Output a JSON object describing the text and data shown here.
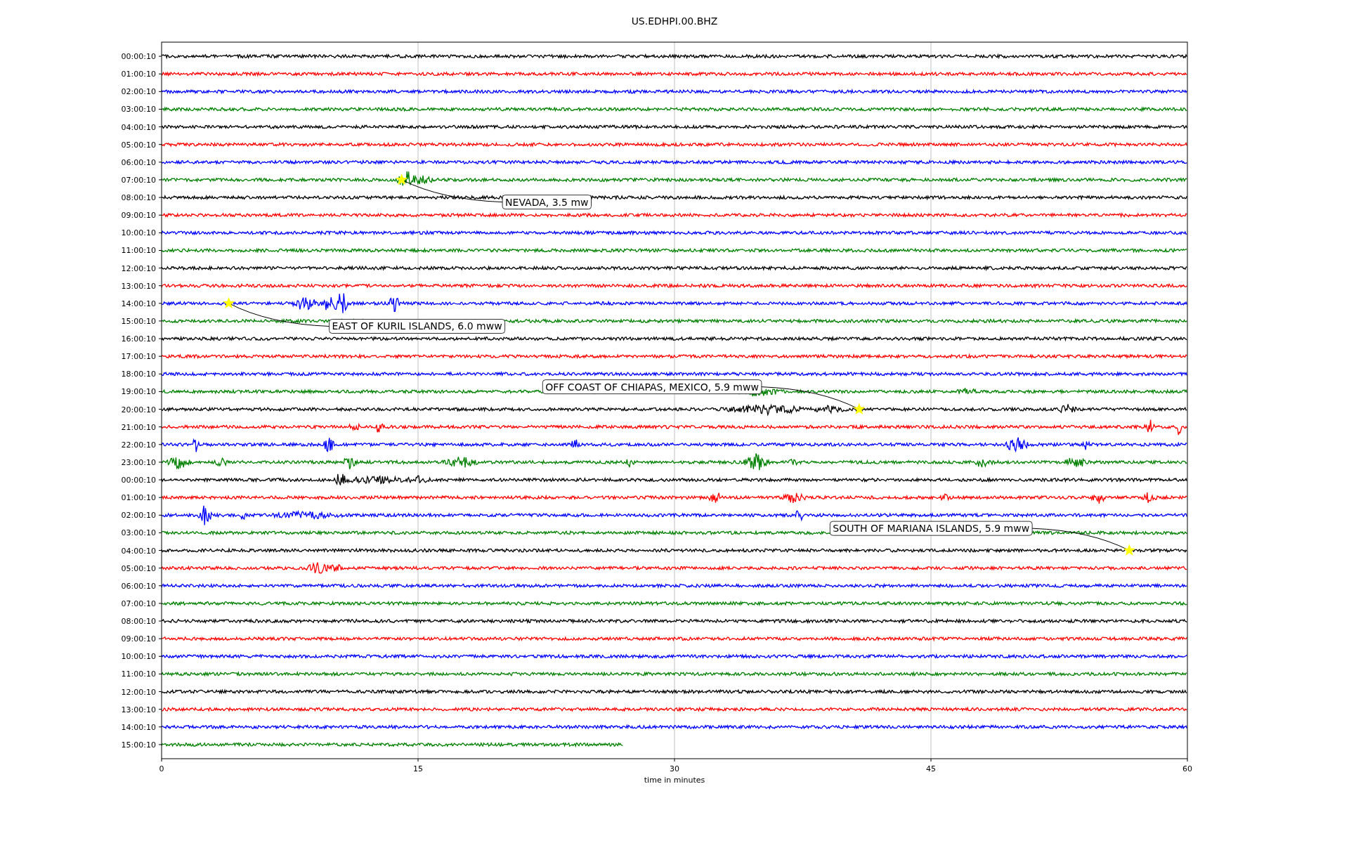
{
  "figure": {
    "title": "US.EDHPI.00.BHZ",
    "rows": [
      {
        "label": "00:00:10",
        "color": "#000000",
        "level": 1
      },
      {
        "label": "01:00:10",
        "color": "#ff0000",
        "level": 1
      },
      {
        "label": "02:00:10",
        "color": "#0000ff",
        "level": 1
      },
      {
        "label": "03:00:10",
        "color": "#008000",
        "level": 1
      },
      {
        "label": "04:00:10",
        "color": "#000000",
        "level": 1
      },
      {
        "label": "05:00:10",
        "color": "#ff0000",
        "level": 1
      },
      {
        "label": "06:00:10",
        "color": "#0000ff",
        "level": 1
      },
      {
        "label": "07:00:10",
        "color": "#008000",
        "level": 1
      },
      {
        "label": "08:00:10",
        "color": "#000000",
        "level": 1
      },
      {
        "label": "09:00:10",
        "color": "#ff0000",
        "level": 1
      },
      {
        "label": "10:00:10",
        "color": "#0000ff",
        "level": 1
      },
      {
        "label": "11:00:10",
        "color": "#008000",
        "level": 1
      },
      {
        "label": "12:00:10",
        "color": "#000000",
        "level": 1
      },
      {
        "label": "13:00:10",
        "color": "#ff0000",
        "level": 1
      },
      {
        "label": "14:00:10",
        "color": "#0000ff",
        "level": 1
      },
      {
        "label": "15:00:10",
        "color": "#008000",
        "level": 1
      },
      {
        "label": "16:00:10",
        "color": "#000000",
        "level": 1
      },
      {
        "label": "17:00:10",
        "color": "#ff0000",
        "level": 1
      },
      {
        "label": "18:00:10",
        "color": "#0000ff",
        "level": 1
      },
      {
        "label": "19:00:10",
        "color": "#008000",
        "level": 1
      },
      {
        "label": "20:00:10",
        "color": "#000000",
        "level": 1
      },
      {
        "label": "21:00:10",
        "color": "#ff0000",
        "level": 1
      },
      {
        "label": "22:00:10",
        "color": "#0000ff",
        "level": 1
      },
      {
        "label": "23:00:10",
        "color": "#008000",
        "level": 1
      },
      {
        "label": "00:00:10",
        "color": "#000000",
        "level": 1
      },
      {
        "label": "01:00:10",
        "color": "#ff0000",
        "level": 1
      },
      {
        "label": "02:00:10",
        "color": "#0000ff",
        "level": 1
      },
      {
        "label": "03:00:10",
        "color": "#008000",
        "level": 1
      },
      {
        "label": "04:00:10",
        "color": "#000000",
        "level": 1
      },
      {
        "label": "05:00:10",
        "color": "#ff0000",
        "level": 1
      },
      {
        "label": "06:00:10",
        "color": "#0000ff",
        "level": 1
      },
      {
        "label": "07:00:10",
        "color": "#008000",
        "level": 1
      },
      {
        "label": "08:00:10",
        "color": "#000000",
        "level": 1
      },
      {
        "label": "09:00:10",
        "color": "#ff0000",
        "level": 1
      },
      {
        "label": "10:00:10",
        "color": "#0000ff",
        "level": 1
      },
      {
        "label": "11:00:10",
        "color": "#008000",
        "level": 1
      },
      {
        "label": "12:00:10",
        "color": "#000000",
        "level": 1
      },
      {
        "label": "13:00:10",
        "color": "#ff0000",
        "level": 1
      },
      {
        "label": "14:00:10",
        "color": "#0000ff",
        "level": 1
      },
      {
        "label": "15:00:10",
        "color": "#008000",
        "level": 0.45
      }
    ],
    "x_axis": {
      "ticks": [
        "0",
        "15",
        "30",
        "45",
        "60"
      ],
      "label": "time in minutes"
    },
    "events": [
      {
        "text": "NEVADA, 3.5 mw"
      },
      {
        "text": "EAST OF KURIL ISLANDS, 6.0 mww"
      },
      {
        "text": "OFF COAST OF CHIAPAS, MEXICO, 5.9 mww"
      },
      {
        "text": "SOUTH OF MARIANA ISLANDS, 5.9 mww"
      }
    ]
  }
}
